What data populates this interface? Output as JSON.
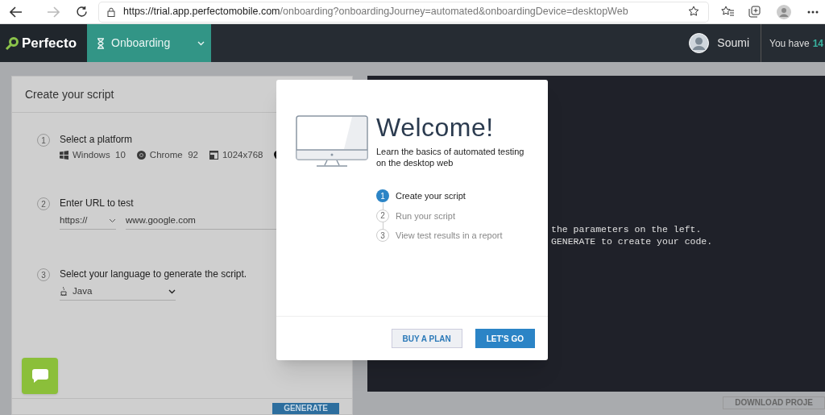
{
  "browser": {
    "url_host": "https://trial.app.perfectomobile.com",
    "url_path": "/onboarding?onboardingJourney=automated&onboardingDevice=desktopWeb"
  },
  "header": {
    "logo": "Perfecto",
    "section": "Onboarding",
    "user": "Soumi",
    "trial_label": "You have",
    "trial_days": "14"
  },
  "script_panel": {
    "title": "Create your script",
    "steps": [
      {
        "number": "1",
        "kind": "platform",
        "label": "Select a platform",
        "options": [
          {
            "kind": "os",
            "text": "Windows  10"
          },
          {
            "kind": "browser",
            "text": "Chrome  92"
          },
          {
            "kind": "resolution",
            "text": "1024x768"
          },
          {
            "kind": "location"
          }
        ]
      },
      {
        "number": "2",
        "kind": "url",
        "label": "Enter URL to test",
        "protocol": "https://",
        "url": "www.google.com"
      },
      {
        "number": "3",
        "kind": "language",
        "label": "Select your language to generate the script.",
        "language": "Java"
      }
    ],
    "generate_button": "GENERATE"
  },
  "code_panel": {
    "lines": [
      "the parameters on the left.",
      "GENERATE to create your code."
    ],
    "download_button": "DOWNLOAD PROJE"
  },
  "modal": {
    "title": "Welcome!",
    "subtitle": "Learn the basics of automated testing on the desktop web",
    "steps": [
      {
        "number": "1",
        "label": "Create your script",
        "selected": true
      },
      {
        "number": "2",
        "label": "Run your script",
        "selected": false
      },
      {
        "number": "3",
        "label": "View test results in a report",
        "selected": false
      }
    ],
    "buttons": [
      {
        "kind": "secondary",
        "label": "BUY A PLAN"
      },
      {
        "kind": "primary",
        "label": "LET'S GO"
      }
    ]
  }
}
